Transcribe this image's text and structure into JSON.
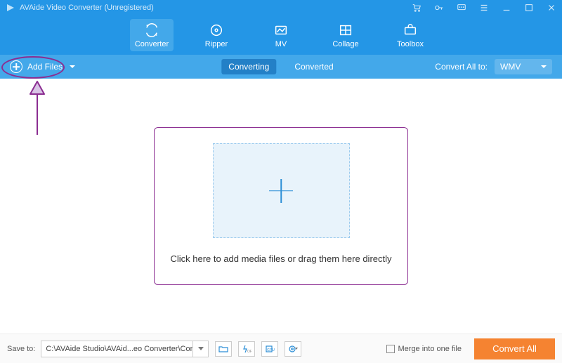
{
  "titlebar": {
    "title": "AVAide Video Converter (Unregistered)"
  },
  "nav": {
    "items": [
      {
        "label": "Converter"
      },
      {
        "label": "Ripper"
      },
      {
        "label": "MV"
      },
      {
        "label": "Collage"
      },
      {
        "label": "Toolbox"
      }
    ]
  },
  "subbar": {
    "add_files_label": "Add Files",
    "tab_converting": "Converting",
    "tab_converted": "Converted",
    "convert_all_label": "Convert All to:",
    "format_selected": "WMV"
  },
  "dropzone": {
    "hint": "Click here to add media files or drag them here directly"
  },
  "footer": {
    "save_to_label": "Save to:",
    "path": "C:\\AVAide Studio\\AVAid...eo Converter\\Converted",
    "merge_label": "Merge into one file",
    "convert_button": "Convert All"
  }
}
